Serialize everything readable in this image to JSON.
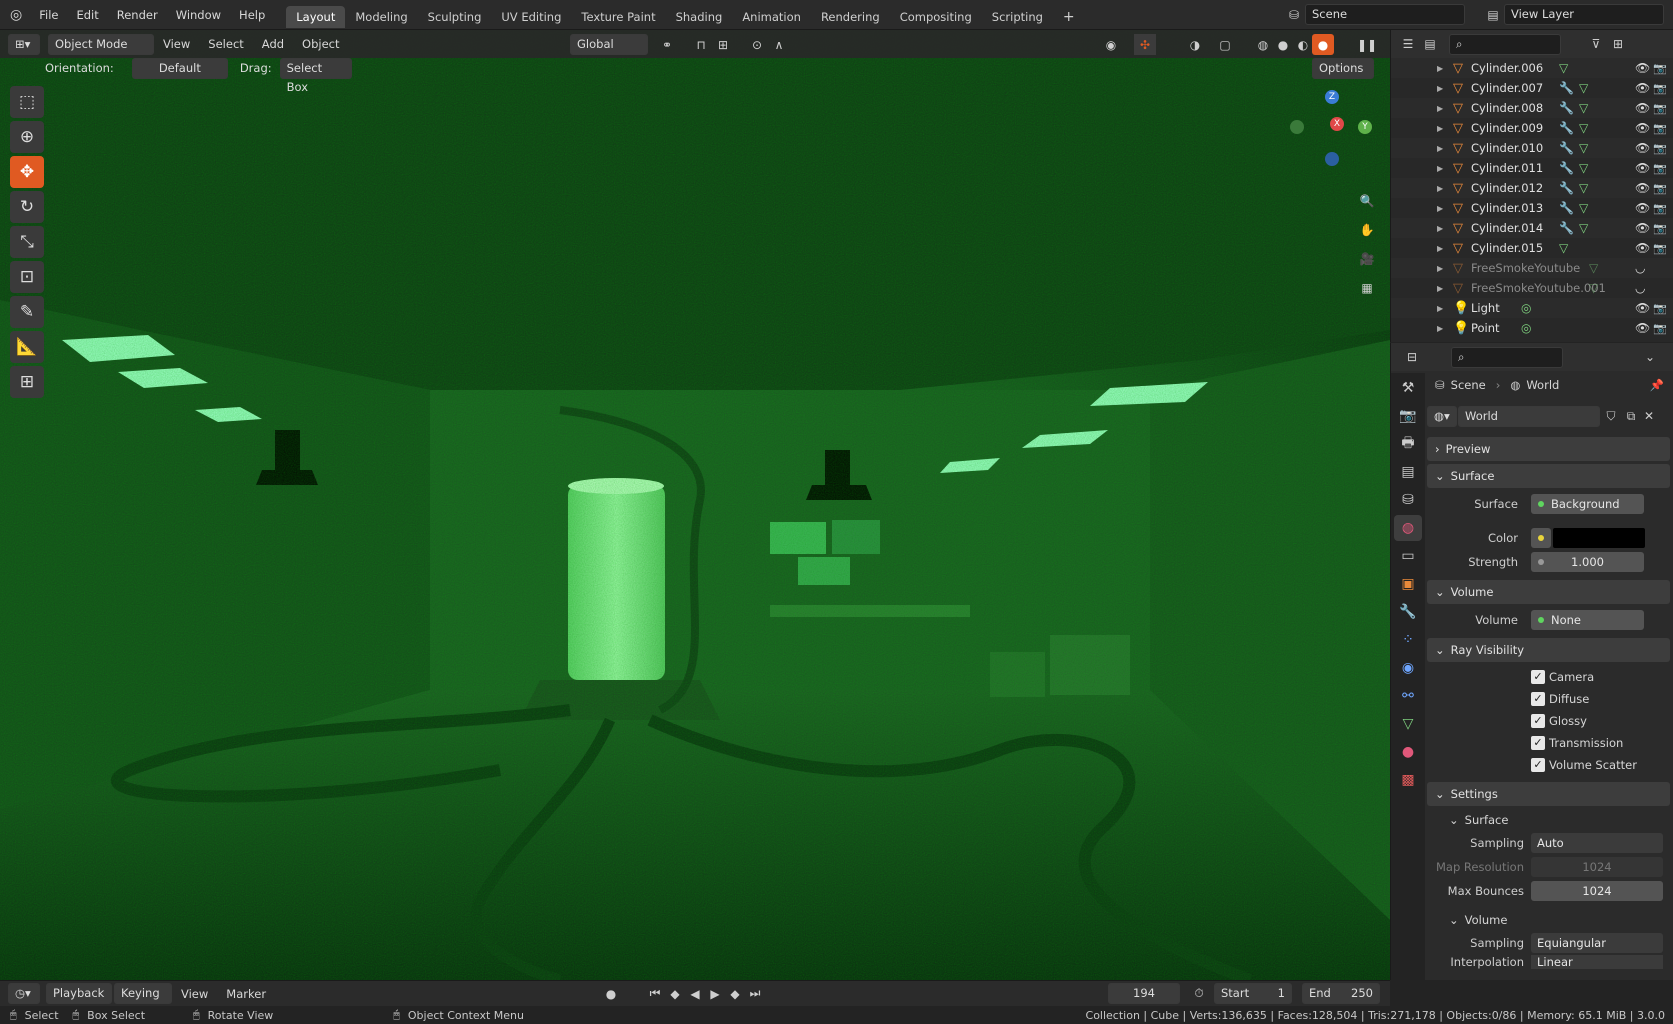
{
  "menubar": {
    "items": [
      "File",
      "Edit",
      "Render",
      "Window",
      "Help"
    ]
  },
  "workspaces": [
    "Layout",
    "Modeling",
    "Sculpting",
    "UV Editing",
    "Texture Paint",
    "Shading",
    "Animation",
    "Rendering",
    "Compositing",
    "Scripting"
  ],
  "scene": {
    "label": "Scene"
  },
  "view_layer": {
    "label": "View Layer"
  },
  "header": {
    "mode": "Object Mode",
    "menus": [
      "View",
      "Select",
      "Add",
      "Object"
    ],
    "transform": "Global"
  },
  "tool_settings": {
    "orientation_label": "Orientation:",
    "orientation": "Default",
    "drag_label": "Drag:",
    "drag": "Select Box",
    "options": "Options"
  },
  "gizmo": {
    "z": "Z",
    "x": "X",
    "y": "Y"
  },
  "outliner": {
    "items": [
      {
        "name": "Cylinder.006",
        "type": "mesh",
        "mod": false,
        "visible": true
      },
      {
        "name": "Cylinder.007",
        "type": "mesh",
        "mod": true,
        "visible": true
      },
      {
        "name": "Cylinder.008",
        "type": "mesh",
        "mod": true,
        "visible": true
      },
      {
        "name": "Cylinder.009",
        "type": "mesh",
        "mod": true,
        "visible": true
      },
      {
        "name": "Cylinder.010",
        "type": "mesh",
        "mod": true,
        "visible": true
      },
      {
        "name": "Cylinder.011",
        "type": "mesh",
        "mod": true,
        "visible": true
      },
      {
        "name": "Cylinder.012",
        "type": "mesh",
        "mod": true,
        "visible": true
      },
      {
        "name": "Cylinder.013",
        "type": "mesh",
        "mod": true,
        "visible": true
      },
      {
        "name": "Cylinder.014",
        "type": "mesh",
        "mod": true,
        "visible": true
      },
      {
        "name": "Cylinder.015",
        "type": "mesh",
        "mod": false,
        "visible": true
      },
      {
        "name": "FreeSmokeYoutube",
        "type": "mesh",
        "mod": false,
        "visible": false
      },
      {
        "name": "FreeSmokeYoutube.001",
        "type": "mesh",
        "mod": false,
        "visible": false
      },
      {
        "name": "Light",
        "type": "light",
        "mod": false,
        "visible": true
      },
      {
        "name": "Point",
        "type": "light",
        "mod": false,
        "visible": true
      }
    ]
  },
  "properties": {
    "breadcrumb": {
      "scene": "Scene",
      "world": "World"
    },
    "world_name": "World",
    "panels": {
      "preview": "Preview",
      "surface": "Surface",
      "volume": "Volume",
      "ray_visibility": "Ray Visibility",
      "settings": "Settings"
    },
    "surface": {
      "label": "Surface",
      "value": "Background",
      "color_label": "Color",
      "strength_label": "Strength",
      "strength": "1.000"
    },
    "volume": {
      "label": "Volume",
      "value": "None"
    },
    "ray": [
      "Camera",
      "Diffuse",
      "Glossy",
      "Transmission",
      "Volume Scatter"
    ],
    "settings": {
      "surface_sub": "Surface",
      "sampling_label": "Sampling",
      "sampling": "Auto",
      "map_res_label": "Map Resolution",
      "map_res": "1024",
      "max_bounces_label": "Max Bounces",
      "max_bounces": "1024",
      "volume_sub": "Volume",
      "vol_sampling_label": "Sampling",
      "vol_sampling": "Equiangular",
      "interp_label": "Interpolation",
      "interp": "Linear"
    }
  },
  "timeline": {
    "playback": "Playback",
    "keying": "Keying",
    "view": "View",
    "marker": "Marker",
    "frame": "194",
    "start_label": "Start",
    "start": "1",
    "end_label": "End",
    "end": "250"
  },
  "statusbar": {
    "select": "Select",
    "box_select": "Box Select",
    "rotate": "Rotate View",
    "context": "Object Context Menu",
    "stats": "Collection | Cube | Verts:136,635 | Faces:128,504 | Tris:271,178 | Objects:0/86 | Memory: 65.1 MiB | 3.0.0"
  },
  "colors": {
    "accent": "#e05a22",
    "viewport_green": "#2e7a35",
    "glow": "#7dffb0"
  }
}
